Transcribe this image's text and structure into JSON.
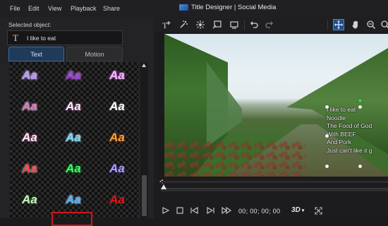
{
  "menu": {
    "file": "File",
    "edit": "Edit",
    "view": "View",
    "playback": "Playback",
    "share": "Share"
  },
  "window": {
    "title": "Title Designer | Social Media"
  },
  "left_panel": {
    "selected_label": "Selected object:",
    "selected_type_icon": "T",
    "selected_value": "I like to eat",
    "tabs": {
      "text": "Text",
      "motion": "Motion"
    },
    "preset_sample": "Aa"
  },
  "preview": {
    "title_lines": [
      "I like to eat",
      "Noodle",
      "The Food of God",
      "With BEEF",
      "And Pork",
      "Just can't like it g"
    ]
  },
  "controls": {
    "timecode": "00; 00; 00; 00",
    "mode_3d": "3D"
  },
  "colors": {
    "accent": "#3a6aa0",
    "selection": "#d0161b",
    "rotate_handle": "#3fd04a"
  }
}
